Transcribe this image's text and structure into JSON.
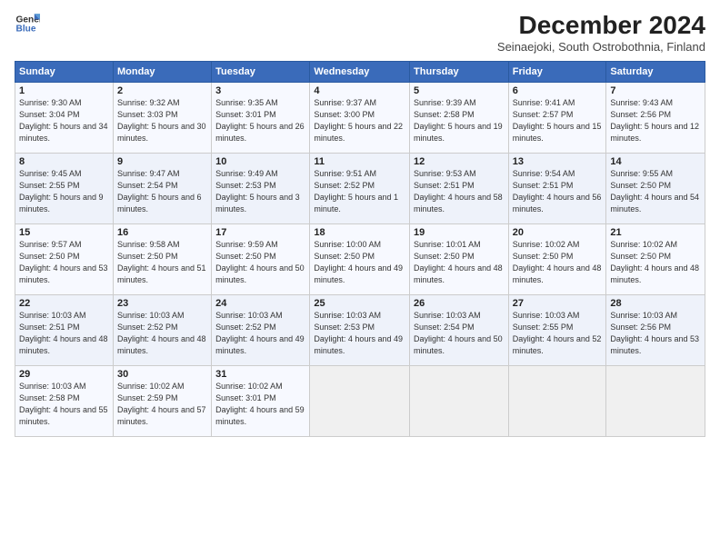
{
  "logo": {
    "line1": "General",
    "line2": "Blue"
  },
  "title": "December 2024",
  "subtitle": "Seinaejoki, South Ostrobothnia, Finland",
  "days_of_week": [
    "Sunday",
    "Monday",
    "Tuesday",
    "Wednesday",
    "Thursday",
    "Friday",
    "Saturday"
  ],
  "weeks": [
    [
      {
        "day": 1,
        "sunrise": "9:30 AM",
        "sunset": "3:04 PM",
        "daylight": "5 hours and 34 minutes."
      },
      {
        "day": 2,
        "sunrise": "9:32 AM",
        "sunset": "3:03 PM",
        "daylight": "5 hours and 30 minutes."
      },
      {
        "day": 3,
        "sunrise": "9:35 AM",
        "sunset": "3:01 PM",
        "daylight": "5 hours and 26 minutes."
      },
      {
        "day": 4,
        "sunrise": "9:37 AM",
        "sunset": "3:00 PM",
        "daylight": "5 hours and 22 minutes."
      },
      {
        "day": 5,
        "sunrise": "9:39 AM",
        "sunset": "2:58 PM",
        "daylight": "5 hours and 19 minutes."
      },
      {
        "day": 6,
        "sunrise": "9:41 AM",
        "sunset": "2:57 PM",
        "daylight": "5 hours and 15 minutes."
      },
      {
        "day": 7,
        "sunrise": "9:43 AM",
        "sunset": "2:56 PM",
        "daylight": "5 hours and 12 minutes."
      }
    ],
    [
      {
        "day": 8,
        "sunrise": "9:45 AM",
        "sunset": "2:55 PM",
        "daylight": "5 hours and 9 minutes."
      },
      {
        "day": 9,
        "sunrise": "9:47 AM",
        "sunset": "2:54 PM",
        "daylight": "5 hours and 6 minutes."
      },
      {
        "day": 10,
        "sunrise": "9:49 AM",
        "sunset": "2:53 PM",
        "daylight": "5 hours and 3 minutes."
      },
      {
        "day": 11,
        "sunrise": "9:51 AM",
        "sunset": "2:52 PM",
        "daylight": "5 hours and 1 minute."
      },
      {
        "day": 12,
        "sunrise": "9:53 AM",
        "sunset": "2:51 PM",
        "daylight": "4 hours and 58 minutes."
      },
      {
        "day": 13,
        "sunrise": "9:54 AM",
        "sunset": "2:51 PM",
        "daylight": "4 hours and 56 minutes."
      },
      {
        "day": 14,
        "sunrise": "9:55 AM",
        "sunset": "2:50 PM",
        "daylight": "4 hours and 54 minutes."
      }
    ],
    [
      {
        "day": 15,
        "sunrise": "9:57 AM",
        "sunset": "2:50 PM",
        "daylight": "4 hours and 53 minutes."
      },
      {
        "day": 16,
        "sunrise": "9:58 AM",
        "sunset": "2:50 PM",
        "daylight": "4 hours and 51 minutes."
      },
      {
        "day": 17,
        "sunrise": "9:59 AM",
        "sunset": "2:50 PM",
        "daylight": "4 hours and 50 minutes."
      },
      {
        "day": 18,
        "sunrise": "10:00 AM",
        "sunset": "2:50 PM",
        "daylight": "4 hours and 49 minutes."
      },
      {
        "day": 19,
        "sunrise": "10:01 AM",
        "sunset": "2:50 PM",
        "daylight": "4 hours and 48 minutes."
      },
      {
        "day": 20,
        "sunrise": "10:02 AM",
        "sunset": "2:50 PM",
        "daylight": "4 hours and 48 minutes."
      },
      {
        "day": 21,
        "sunrise": "10:02 AM",
        "sunset": "2:50 PM",
        "daylight": "4 hours and 48 minutes."
      }
    ],
    [
      {
        "day": 22,
        "sunrise": "10:03 AM",
        "sunset": "2:51 PM",
        "daylight": "4 hours and 48 minutes."
      },
      {
        "day": 23,
        "sunrise": "10:03 AM",
        "sunset": "2:52 PM",
        "daylight": "4 hours and 48 minutes."
      },
      {
        "day": 24,
        "sunrise": "10:03 AM",
        "sunset": "2:52 PM",
        "daylight": "4 hours and 49 minutes."
      },
      {
        "day": 25,
        "sunrise": "10:03 AM",
        "sunset": "2:53 PM",
        "daylight": "4 hours and 49 minutes."
      },
      {
        "day": 26,
        "sunrise": "10:03 AM",
        "sunset": "2:54 PM",
        "daylight": "4 hours and 50 minutes."
      },
      {
        "day": 27,
        "sunrise": "10:03 AM",
        "sunset": "2:55 PM",
        "daylight": "4 hours and 52 minutes."
      },
      {
        "day": 28,
        "sunrise": "10:03 AM",
        "sunset": "2:56 PM",
        "daylight": "4 hours and 53 minutes."
      }
    ],
    [
      {
        "day": 29,
        "sunrise": "10:03 AM",
        "sunset": "2:58 PM",
        "daylight": "4 hours and 55 minutes."
      },
      {
        "day": 30,
        "sunrise": "10:02 AM",
        "sunset": "2:59 PM",
        "daylight": "4 hours and 57 minutes."
      },
      {
        "day": 31,
        "sunrise": "10:02 AM",
        "sunset": "3:01 PM",
        "daylight": "4 hours and 59 minutes."
      },
      null,
      null,
      null,
      null
    ]
  ]
}
